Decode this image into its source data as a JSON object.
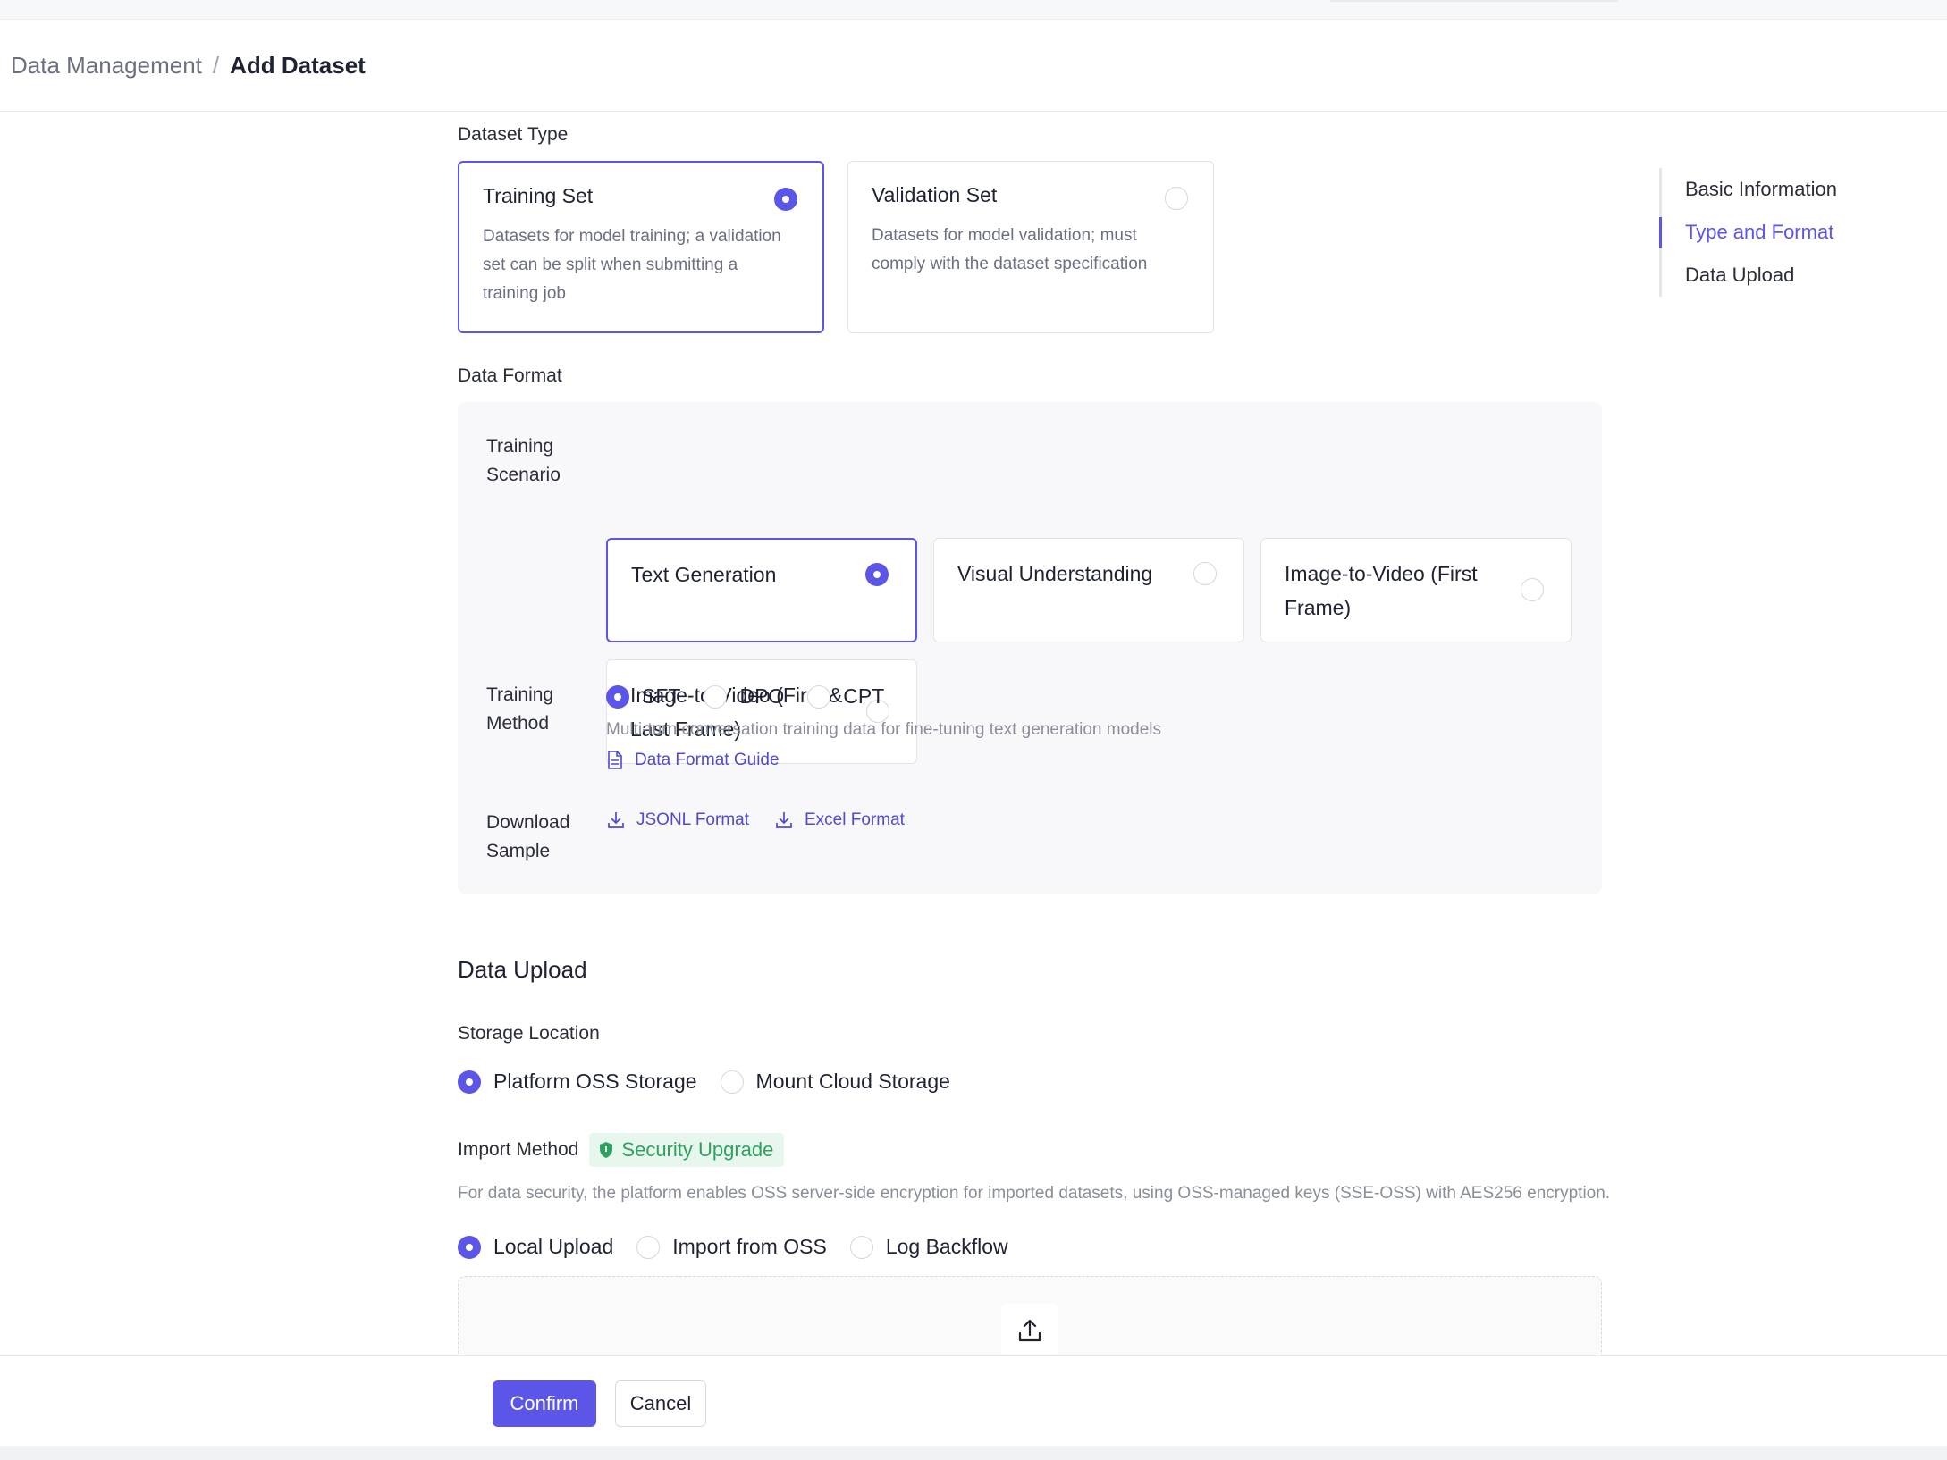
{
  "breadcrumb": {
    "parent": "Data Management",
    "separator": "/",
    "current": "Add Dataset"
  },
  "dataset_type": {
    "label": "Dataset Type",
    "options": [
      {
        "title": "Training Set",
        "description": "Datasets for model training; a validation set can be split when submitting a training job",
        "selected": true
      },
      {
        "title": "Validation Set",
        "description": "Datasets for model validation; must comply with the dataset specification",
        "selected": false
      }
    ]
  },
  "data_format": {
    "label": "Data Format",
    "training_scenario": {
      "label": "Training Scenario",
      "options": [
        {
          "title": "Text Generation",
          "selected": true
        },
        {
          "title": "Visual Understanding",
          "selected": false
        },
        {
          "title": "Image-to-Video (First Frame)",
          "selected": false
        },
        {
          "title": "Image-to-Video (First & Last Frame)",
          "selected": false
        }
      ]
    },
    "training_method": {
      "label": "Training Method",
      "options": [
        {
          "label": "SFT",
          "selected": true
        },
        {
          "label": "DPO",
          "selected": false
        },
        {
          "label": "CPT",
          "selected": false
        }
      ],
      "hint": "Multi-turn conversation training data for fine-tuning text generation models",
      "guide_link": "Data Format Guide"
    },
    "download_sample": {
      "label": "Download Sample",
      "links": [
        "JSONL Format",
        "Excel Format"
      ]
    }
  },
  "data_upload": {
    "title": "Data Upload",
    "storage_location": {
      "label": "Storage Location",
      "options": [
        {
          "label": "Platform OSS Storage",
          "selected": true
        },
        {
          "label": "Mount Cloud Storage",
          "selected": false
        }
      ]
    },
    "import_method": {
      "label": "Import Method",
      "badge": "Security Upgrade",
      "hint": "For data security, the platform enables OSS server-side encryption for imported datasets, using OSS-managed keys (SSE-OSS) with AES256 encryption.",
      "options": [
        {
          "label": "Local Upload",
          "selected": true
        },
        {
          "label": "Import from OSS",
          "selected": false
        },
        {
          "label": "Log Backflow",
          "selected": false
        }
      ]
    }
  },
  "anchor_nav": {
    "items": [
      {
        "label": "Basic Information",
        "active": false
      },
      {
        "label": "Type and Format",
        "active": true
      },
      {
        "label": "Data Upload",
        "active": false
      }
    ]
  },
  "footer": {
    "confirm_label": "Confirm",
    "cancel_label": "Cancel"
  },
  "colors": {
    "accent": "#5b55e8",
    "link": "#4f49d6",
    "success": "#2ea15d",
    "success_bg": "#e8f7ee"
  },
  "icons": {
    "radio_on": "radio-checked",
    "radio_off": "radio-unchecked",
    "guide": "document-icon",
    "download": "download-icon",
    "shield": "shield-icon",
    "upload": "upload-icon"
  }
}
